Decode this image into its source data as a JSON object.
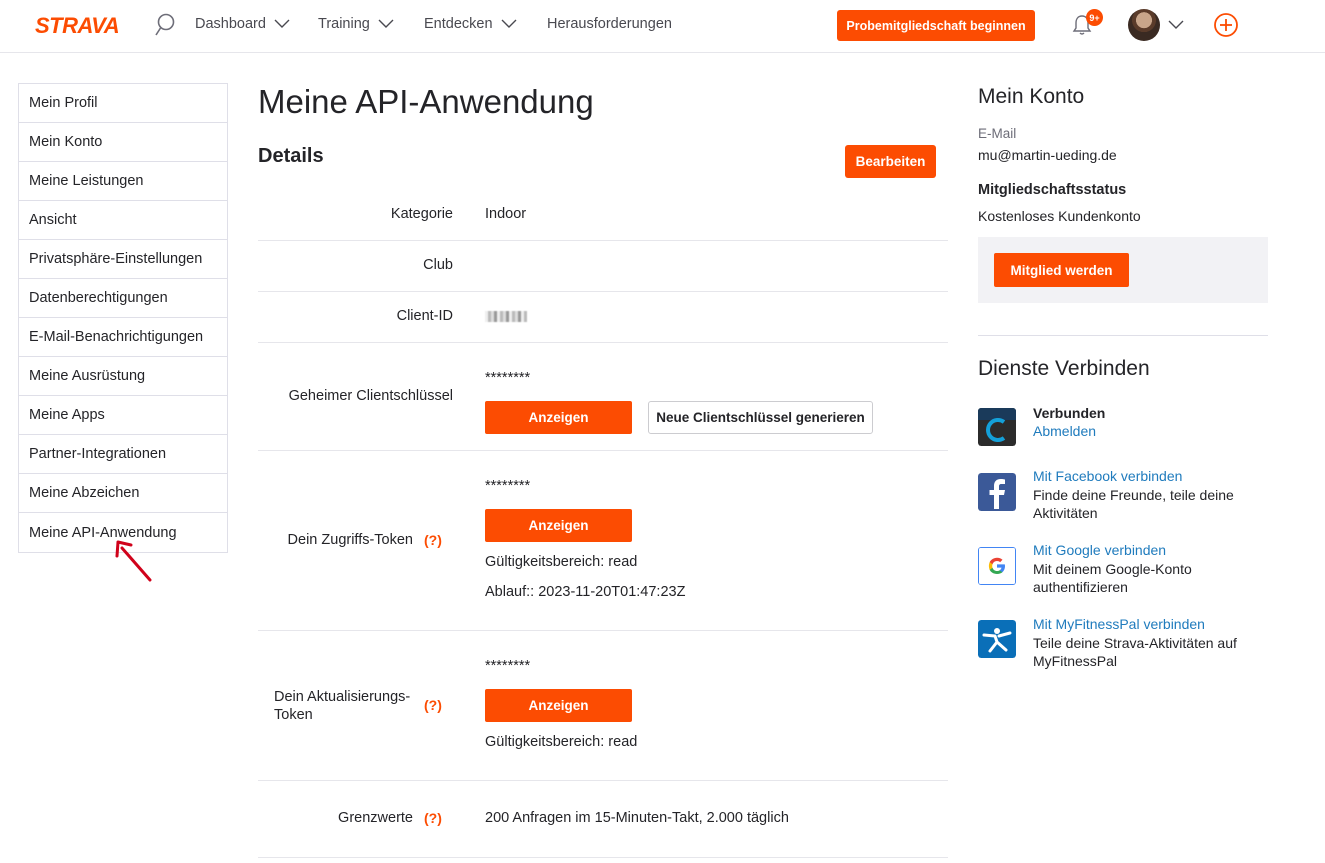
{
  "header": {
    "logo_text": "STRAVA",
    "nav": [
      {
        "label": "Dashboard"
      },
      {
        "label": "Training"
      },
      {
        "label": "Entdecken"
      },
      {
        "label": "Herausforderungen"
      }
    ],
    "trial_button": "Probemitgliedschaft beginnen",
    "notification_badge": "9+",
    "icons": [
      "search-icon",
      "bell-icon",
      "avatar",
      "chevron-down-icon",
      "plus-circle-icon"
    ]
  },
  "sidebar": {
    "items": [
      {
        "label": "Mein Profil"
      },
      {
        "label": "Mein Konto"
      },
      {
        "label": "Meine Leistungen"
      },
      {
        "label": "Ansicht"
      },
      {
        "label": "Privatsphäre-Einstellungen"
      },
      {
        "label": "Datenberechtigungen"
      },
      {
        "label": "E-Mail-Benachrichtigungen"
      },
      {
        "label": "Meine Ausrüstung"
      },
      {
        "label": "Meine Apps"
      },
      {
        "label": "Partner-Integrationen"
      },
      {
        "label": "Meine Abzeichen"
      },
      {
        "label": "Meine API-Anwendung"
      }
    ],
    "active": "Meine API-Anwendung"
  },
  "main": {
    "title": "Meine API-Anwendung",
    "section_title": "Details",
    "edit_button": "Bearbeiten",
    "rows": {
      "category": {
        "label": "Kategorie",
        "value": "Indoor"
      },
      "club": {
        "label": "Club",
        "value": ""
      },
      "client_id": {
        "label": "Client-ID"
      },
      "client_secret": {
        "label": "Geheimer Clientschlüssel",
        "value": "********",
        "show_button": "Anzeigen",
        "regenerate_button": "Neue Clientschlüssel generieren"
      },
      "access_token": {
        "label": "Dein Zugriffs-Token",
        "help": "(?)",
        "value": "********",
        "show_button": "Anzeigen",
        "scope": "Gültigkeitsbereich: read",
        "expiry": "Ablauf:: 2023-11-20T01:47:23Z"
      },
      "refresh_token": {
        "label_line1": "Dein Aktualisierungs-",
        "label_line2": "Token",
        "help": "(?)",
        "value": "********",
        "show_button": "Anzeigen",
        "scope": "Gültigkeitsbereich: read"
      },
      "limits": {
        "label": "Grenzwerte",
        "help": "(?)",
        "value": "200 Anfragen im 15-Minuten-Takt, 2.000 täglich"
      }
    }
  },
  "account": {
    "title": "Mein Konto",
    "email_label": "E-Mail",
    "email": "mu@martin-ueding.de",
    "status_label": "Mitgliedschaftsstatus",
    "status": "Kostenloses Kundenkonto",
    "member_button": "Mitglied werden"
  },
  "services": {
    "title": "Dienste Verbinden",
    "items": [
      {
        "icon": "garmin-icon",
        "status": "Verbunden",
        "link": "Abmelden",
        "color": "#1a3a5a"
      },
      {
        "icon": "facebook-icon",
        "link": "Mit Facebook verbinden",
        "desc": "Finde deine Freunde, teile deine Aktivitäten",
        "color": "#3b5998"
      },
      {
        "icon": "google-icon",
        "link": "Mit Google verbinden",
        "desc": "Mit deinem Google-Konto authentifizieren",
        "color": "#4285f4"
      },
      {
        "icon": "myfitnesspal-icon",
        "link": "Mit MyFitnessPal verbinden",
        "desc": "Teile deine Strava-Aktivitäten auf MyFitnessPal",
        "color": "#0a6fb8"
      }
    ]
  },
  "colors": {
    "brand": "#fc4c02",
    "link": "#1f7bbd",
    "text": "#242428",
    "border": "#dfdfe8"
  }
}
